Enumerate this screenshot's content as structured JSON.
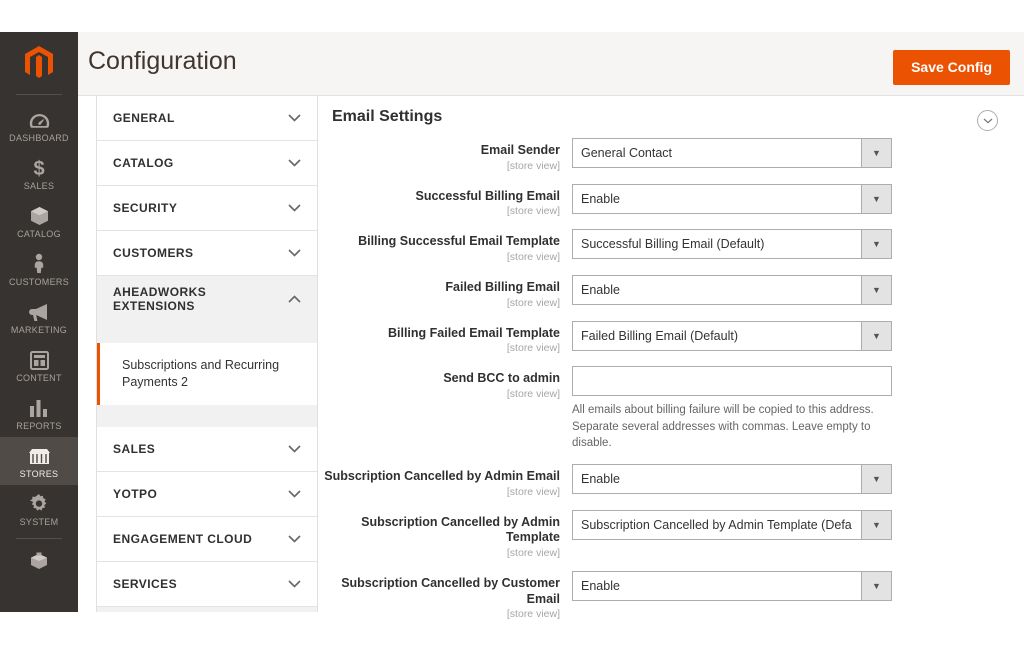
{
  "header": {
    "title": "Configuration",
    "save_label": "Save Config",
    "logo_icon": "magento-logo-icon"
  },
  "leftnav": {
    "items": [
      {
        "label": "Dashboard",
        "icon": "dashboard-gauge-icon",
        "active": false
      },
      {
        "label": "Sales",
        "icon": "dollar-sign-icon",
        "active": false
      },
      {
        "label": "Catalog",
        "icon": "box-icon",
        "active": false
      },
      {
        "label": "Customers",
        "icon": "person-icon",
        "active": false
      },
      {
        "label": "Marketing",
        "icon": "megaphone-icon",
        "active": false
      },
      {
        "label": "Content",
        "icon": "layout-window-icon",
        "active": false
      },
      {
        "label": "Reports",
        "icon": "bar-chart-icon",
        "active": false
      },
      {
        "label": "Stores",
        "icon": "storefront-icon",
        "active": true
      },
      {
        "label": "System",
        "icon": "gear-icon",
        "active": false
      },
      {
        "label": "",
        "icon": "extensions-cube-icon",
        "active": false
      }
    ]
  },
  "confignav": {
    "sections": [
      {
        "label": "General",
        "expanded": false,
        "icon": "chevron-down-icon"
      },
      {
        "label": "Catalog",
        "expanded": false,
        "icon": "chevron-down-icon"
      },
      {
        "label": "Security",
        "expanded": false,
        "icon": "chevron-down-icon"
      },
      {
        "label": "Customers",
        "expanded": false,
        "icon": "chevron-down-icon"
      },
      {
        "label": "Aheadworks Extensions",
        "expanded": true,
        "icon": "chevron-up-icon"
      }
    ],
    "active_sub": "Subscriptions and Recurring Payments 2",
    "sections_after": [
      {
        "label": "Sales",
        "expanded": false,
        "icon": "chevron-down-icon"
      },
      {
        "label": "Yotpo",
        "expanded": false,
        "icon": "chevron-down-icon"
      },
      {
        "label": "Engagement Cloud",
        "expanded": false,
        "icon": "chevron-down-icon"
      },
      {
        "label": "Services",
        "expanded": false,
        "icon": "chevron-down-icon"
      }
    ]
  },
  "main": {
    "section_title": "Email Settings",
    "collapse_icon": "chevron-down-circle-icon",
    "scope_label": "[store view]",
    "fields": [
      {
        "label": "Email Sender",
        "scope": "[store view]",
        "type": "select",
        "value": "General Contact"
      },
      {
        "label": "Successful Billing Email",
        "scope": "[store view]",
        "type": "select",
        "value": "Enable"
      },
      {
        "label": "Billing Successful Email Template",
        "scope": "[store view]",
        "type": "select",
        "value": "Successful Billing Email (Default)"
      },
      {
        "label": "Failed Billing Email",
        "scope": "[store view]",
        "type": "select",
        "value": "Enable"
      },
      {
        "label": "Billing Failed Email Template",
        "scope": "[store view]",
        "type": "select",
        "value": "Failed Billing Email (Default)"
      },
      {
        "label": "Send BCC to admin",
        "scope": "[store view]",
        "type": "text",
        "value": "",
        "placeholder": "",
        "helper_line1": "All emails about billing failure will be copied to this address.",
        "helper_line2": "Separate several addresses with commas. Leave empty to disable."
      },
      {
        "label": "Subscription Cancelled by Admin Email",
        "scope": "[store view]",
        "type": "select",
        "value": "Enable"
      },
      {
        "label": "Subscription Cancelled by Admin Template",
        "scope": "[store view]",
        "type": "select",
        "value": "Subscription Cancelled by Admin Template (Defa"
      },
      {
        "label": "Subscription Cancelled by Customer Email",
        "scope": "[store view]",
        "type": "select",
        "value": "Enable"
      }
    ]
  },
  "colors": {
    "accent_orange": "#eb5202",
    "nav_dark": "#373330",
    "nav_active": "#504b47",
    "header_bg": "#f7f5f4",
    "panel_grey": "#f1f1f1"
  }
}
